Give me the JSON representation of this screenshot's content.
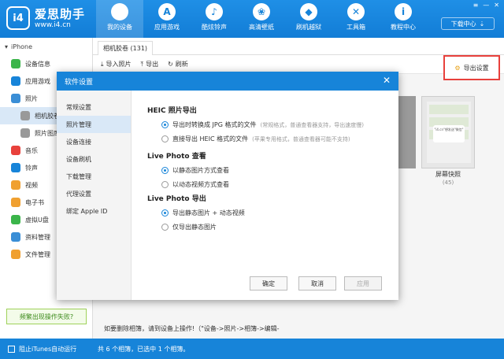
{
  "app": {
    "name": "爱思助手",
    "url": "www.i4.cn",
    "logo": "i4"
  },
  "nav": [
    {
      "label": "我的设备",
      "icon": "apple-icon",
      "glyph": "",
      "active": true
    },
    {
      "label": "应用游戏",
      "icon": "app-store-icon",
      "glyph": "A"
    },
    {
      "label": "酷炫铃声",
      "icon": "bell-icon",
      "glyph": "♪"
    },
    {
      "label": "高清壁纸",
      "icon": "flower-icon",
      "glyph": "❀"
    },
    {
      "label": "刷机越狱",
      "icon": "dropbox-icon",
      "glyph": "◆"
    },
    {
      "label": "工具箱",
      "icon": "tools-icon",
      "glyph": "✕"
    },
    {
      "label": "教程中心",
      "icon": "info-icon",
      "glyph": "i"
    }
  ],
  "download_center": "下载中心",
  "sidebar": {
    "device": "iPhone",
    "items": [
      {
        "label": "设备信息",
        "icon": "info-circle-icon",
        "color": "#3bb54a"
      },
      {
        "label": "应用游戏",
        "icon": "apps-icon",
        "color": "#1784d9"
      },
      {
        "label": "照片",
        "icon": "photo-icon",
        "color": "#3a8ed6"
      },
      {
        "label": "相机胶卷",
        "icon": "folder-icon",
        "color": "#999999",
        "sub": true,
        "active": true
      },
      {
        "label": "照片图库",
        "icon": "folder-icon",
        "color": "#999999",
        "sub": true
      },
      {
        "label": "音乐",
        "icon": "music-icon",
        "color": "#e8413c"
      },
      {
        "label": "铃声",
        "icon": "bell-icon",
        "color": "#1784d9"
      },
      {
        "label": "视频",
        "icon": "video-icon",
        "color": "#f0a030"
      },
      {
        "label": "电子书",
        "icon": "book-icon",
        "color": "#f0a030"
      },
      {
        "label": "虚拟U盘",
        "icon": "usb-icon",
        "color": "#3bb54a"
      },
      {
        "label": "资料管理",
        "icon": "data-icon",
        "color": "#3a8ed6"
      },
      {
        "label": "文件管理",
        "icon": "file-icon",
        "color": "#f0a030"
      }
    ],
    "help": "频繁出现操作失败?"
  },
  "main": {
    "tab": "相机胶卷 (131)",
    "toolbar": {
      "import": "导入照片",
      "export": "导出",
      "refresh": "刷新"
    },
    "export_settings": "导出设置",
    "thumb_text": "\"i4.cn\"想发送\"微信\"",
    "photo_name": "屏幕快照",
    "photo_count": "(45)",
    "delete_hint": "如要删除相簿，请到设备上操作!（\"设备->照片->相簿->编辑-"
  },
  "bottom": {
    "itunes": "阻止iTunes自动运行",
    "status": "共 6 个相簿，已选中 1 个相簿。"
  },
  "dialog": {
    "title": "软件设置",
    "nav": [
      "常规设置",
      "照片管理",
      "设备连接",
      "设备刷机",
      "下载管理",
      "代理设置",
      "绑定 Apple ID"
    ],
    "active_nav": 1,
    "sections": {
      "heic": {
        "title": "HEIC 照片导出",
        "options": [
          {
            "label": "导出时转换成 JPG 格式的文件",
            "note": "(常规格式，普通查看器支持，导出速度慢)",
            "checked": true
          },
          {
            "label": "直接导出 HEIC 格式的文件",
            "note": "(苹果专用格式，普通查看器可能不支持)",
            "checked": false
          }
        ]
      },
      "view": {
        "title": "Live Photo 查看",
        "options": [
          {
            "label": "以静态图片方式查看",
            "checked": true
          },
          {
            "label": "以动态视频方式查看",
            "checked": false
          }
        ]
      },
      "export": {
        "title": "Live Photo 导出",
        "options": [
          {
            "label": "导出静态图片 + 动态视频",
            "checked": true
          },
          {
            "label": "仅导出静态图片",
            "checked": false
          }
        ]
      }
    },
    "buttons": {
      "ok": "确定",
      "cancel": "取消",
      "apply": "应用"
    }
  }
}
